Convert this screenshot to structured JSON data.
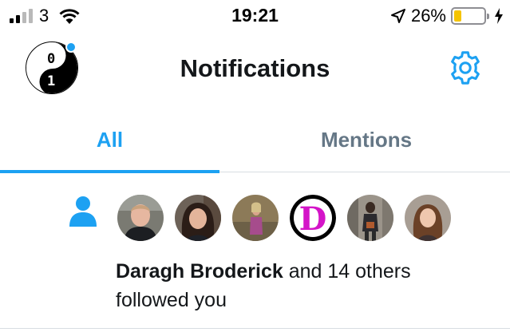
{
  "status_bar": {
    "carrier": "3",
    "time": "19:21",
    "battery_percent": "26%",
    "battery_level": 0.26,
    "signal_bars_filled": 2,
    "signal_bars_total": 4,
    "icons": [
      "signal-icon",
      "wifi-icon",
      "location-arrow-icon",
      "battery-icon",
      "charging-bolt-icon"
    ]
  },
  "header": {
    "title": "Notifications",
    "avatar": {
      "label_top": "0",
      "label_bottom": "1",
      "has_unread_dot": true
    },
    "settings_icon": "gear-icon"
  },
  "tabs": [
    {
      "label": "All",
      "active": true
    },
    {
      "label": "Mentions",
      "active": false
    }
  ],
  "colors": {
    "accent": "#1da1f2",
    "text_primary": "#14171a",
    "text_secondary": "#657786",
    "divider": "#d8dde2"
  },
  "notification": {
    "type_icon": "person-follow-icon",
    "avatars": [
      {
        "name": "avatar-1",
        "kind": "photo"
      },
      {
        "name": "avatar-2",
        "kind": "photo"
      },
      {
        "name": "avatar-3",
        "kind": "photo"
      },
      {
        "name": "avatar-4",
        "kind": "logo",
        "letter": "D"
      },
      {
        "name": "avatar-5",
        "kind": "photo"
      },
      {
        "name": "avatar-6",
        "kind": "photo"
      }
    ],
    "actor_name": "Daragh Broderick",
    "rest_line1": " and 14 others",
    "rest_line2": "followed you"
  }
}
